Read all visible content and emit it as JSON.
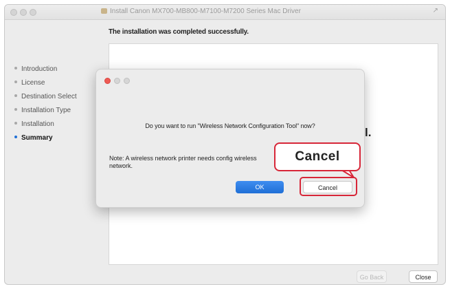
{
  "window": {
    "title": "Install Canon MX700-MB800-M7100-M7200 Series Mac Driver"
  },
  "heading": "The installation was completed successfully.",
  "sidebar": {
    "steps": [
      {
        "label": "Introduction",
        "active": false
      },
      {
        "label": "License",
        "active": false
      },
      {
        "label": "Destination Select",
        "active": false
      },
      {
        "label": "Installation Type",
        "active": false
      },
      {
        "label": "Installation",
        "active": false
      },
      {
        "label": "Summary",
        "active": true
      }
    ]
  },
  "content": {
    "partial_text": "l."
  },
  "footer": {
    "go_back_label": "Go Back",
    "close_label": "Close"
  },
  "dialog": {
    "question": "Do you want to run \"Wireless Network Configuration Tool\" now?",
    "note": "Note: A wireless network printer needs config wireless network.",
    "ok_label": "OK",
    "cancel_label": "Cancel"
  },
  "callout": {
    "label": "Cancel",
    "color": "#d72638"
  },
  "colors": {
    "accent": "#1f6fd6",
    "highlight": "#d72638"
  }
}
